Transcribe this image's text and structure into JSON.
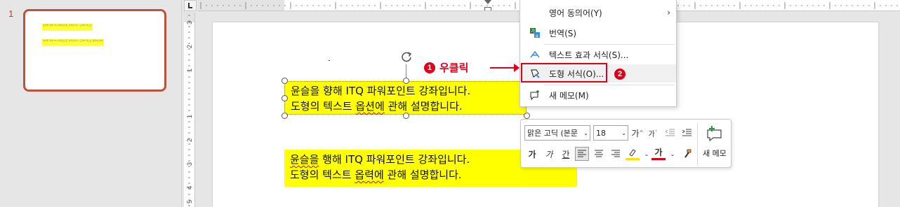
{
  "thumbnails": {
    "slide_number": "1",
    "lines": [
      "윤슬을 향해 ITQ 파워포인트 강좌입니다. 도형의 텍스트 옵션에 관해 설명합니다.",
      "윤슬을 향해 ITQ 파워포인트 강좌입니다. 도형의 텍스트 옵력에 관해 설명합니다."
    ]
  },
  "ruler": {
    "vertical_numbers": [
      "3",
      "2",
      "1",
      "1",
      "2",
      "3",
      "4",
      "5"
    ]
  },
  "slide": {
    "textbox1": {
      "line1": "윤슬을 향해 ITQ 파워포인트 강좌입니다.",
      "line2_a": "도형의 텍스트 ",
      "line2_b": "옵션에",
      "line2_c": " 관해 설명합니다."
    },
    "textbox2": {
      "line1_a": "윤슬을",
      "line1_b": " 행해 ITQ 파워포인트 강좌입니다.",
      "line2_a": "도형의 텍스트 ",
      "line2_b": "옵력에",
      "line2_c": " 관해 설명합니다."
    }
  },
  "annotations": {
    "step1_badge": "1",
    "step1_label": "우클릭",
    "step2_badge": "2",
    "accent": "#e0001b"
  },
  "context_menu": {
    "items": [
      {
        "icon": "blank",
        "label": "영어 동의어(Y)",
        "has_submenu": true
      },
      {
        "icon": "translate-icon",
        "label": "번역(S)"
      },
      {
        "icon": "text-effects-icon",
        "label": "텍스트 효과 서식(S)..."
      },
      {
        "icon": "format-shape-icon",
        "label": "도형 서식(O)..."
      },
      {
        "icon": "new-comment-icon",
        "label": "새 메모(M)"
      }
    ],
    "submenu_glyph": "›"
  },
  "mini_toolbar": {
    "font_name": "맑은 고딕 (본문",
    "font_size": "18",
    "grow_font": "가",
    "shrink_font": "가",
    "bold": "가",
    "italic": "가",
    "underline": "간",
    "font_color_letter": "가",
    "new_comment_label": "새 메모"
  },
  "colors": {
    "highlight": "#ffff00",
    "thumb_border": "#c0503a"
  }
}
